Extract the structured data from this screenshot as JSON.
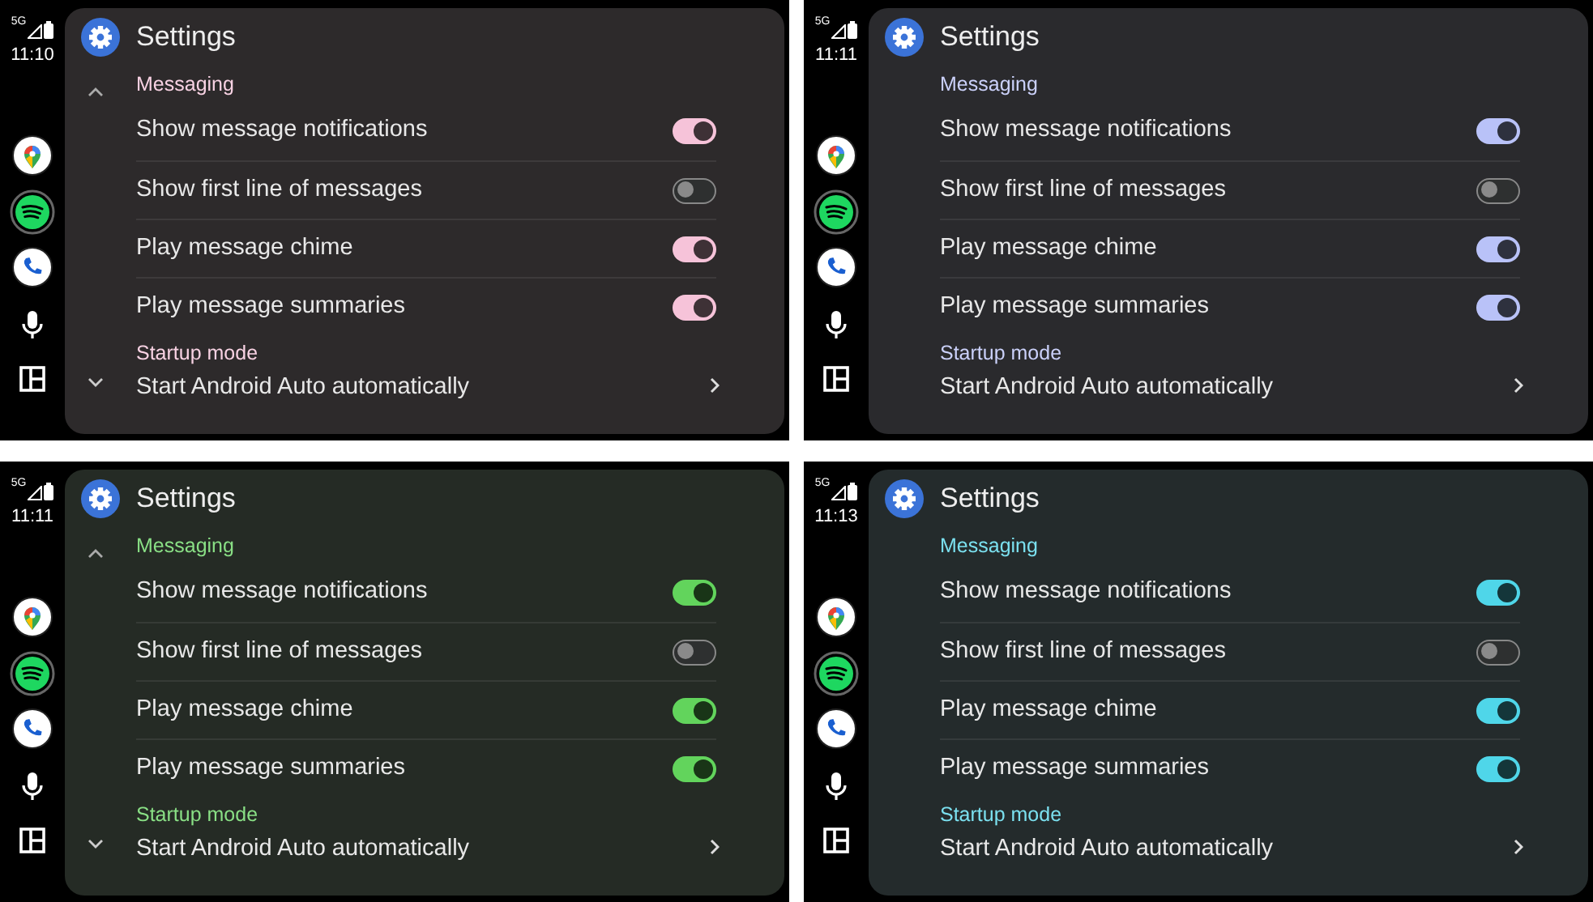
{
  "panels": [
    {
      "color": "#f6c3d9",
      "scroll_arrows": true,
      "status": {
        "network": "5G",
        "time": "11:10"
      },
      "title": "Settings",
      "sections": [
        {
          "header": "Messaging",
          "items": [
            {
              "kind": "toggle",
              "label": "Show message notifications",
              "on": true
            },
            {
              "kind": "toggle",
              "label": "Show first line of messages",
              "on": false
            },
            {
              "kind": "toggle",
              "label": "Play message chime",
              "on": true
            },
            {
              "kind": "toggle",
              "label": "Play message summaries",
              "on": true
            }
          ]
        },
        {
          "header": "Startup mode",
          "items": [
            {
              "kind": "link",
              "label": "Start Android Auto automatically"
            }
          ]
        }
      ]
    },
    {
      "color": "#b9c2f8",
      "scroll_arrows": false,
      "status": {
        "network": "5G",
        "time": "11:11"
      },
      "title": "Settings",
      "sections": [
        {
          "header": "Messaging",
          "items": [
            {
              "kind": "toggle",
              "label": "Show message notifications",
              "on": true
            },
            {
              "kind": "toggle",
              "label": "Show first line of messages",
              "on": false
            },
            {
              "kind": "toggle",
              "label": "Play message chime",
              "on": true
            },
            {
              "kind": "toggle",
              "label": "Play message summaries",
              "on": true
            }
          ]
        },
        {
          "header": "Startup mode",
          "items": [
            {
              "kind": "link",
              "label": "Start Android Auto automatically"
            }
          ]
        }
      ]
    },
    {
      "color": "#62d45c",
      "scroll_arrows": true,
      "status": {
        "network": "5G",
        "time": "11:11"
      },
      "title": "Settings",
      "sections": [
        {
          "header": "Messaging",
          "items": [
            {
              "kind": "toggle",
              "label": "Show message notifications",
              "on": true
            },
            {
              "kind": "toggle",
              "label": "Show first line of messages",
              "on": false
            },
            {
              "kind": "toggle",
              "label": "Play message chime",
              "on": true
            },
            {
              "kind": "toggle",
              "label": "Play message summaries",
              "on": true
            }
          ]
        },
        {
          "header": "Startup mode",
          "items": [
            {
              "kind": "link",
              "label": "Start Android Auto automatically"
            }
          ]
        }
      ]
    },
    {
      "color": "#4fd6e9",
      "scroll_arrows": false,
      "status": {
        "network": "5G",
        "time": "11:13"
      },
      "title": "Settings",
      "sections": [
        {
          "header": "Messaging",
          "items": [
            {
              "kind": "toggle",
              "label": "Show message notifications",
              "on": true
            },
            {
              "kind": "toggle",
              "label": "Show first line of messages",
              "on": false
            },
            {
              "kind": "toggle",
              "label": "Play message chime",
              "on": true
            },
            {
              "kind": "toggle",
              "label": "Play message summaries",
              "on": true
            }
          ]
        },
        {
          "header": "Startup mode",
          "items": [
            {
              "kind": "link",
              "label": "Start Android Auto automatically"
            }
          ]
        }
      ]
    }
  ]
}
